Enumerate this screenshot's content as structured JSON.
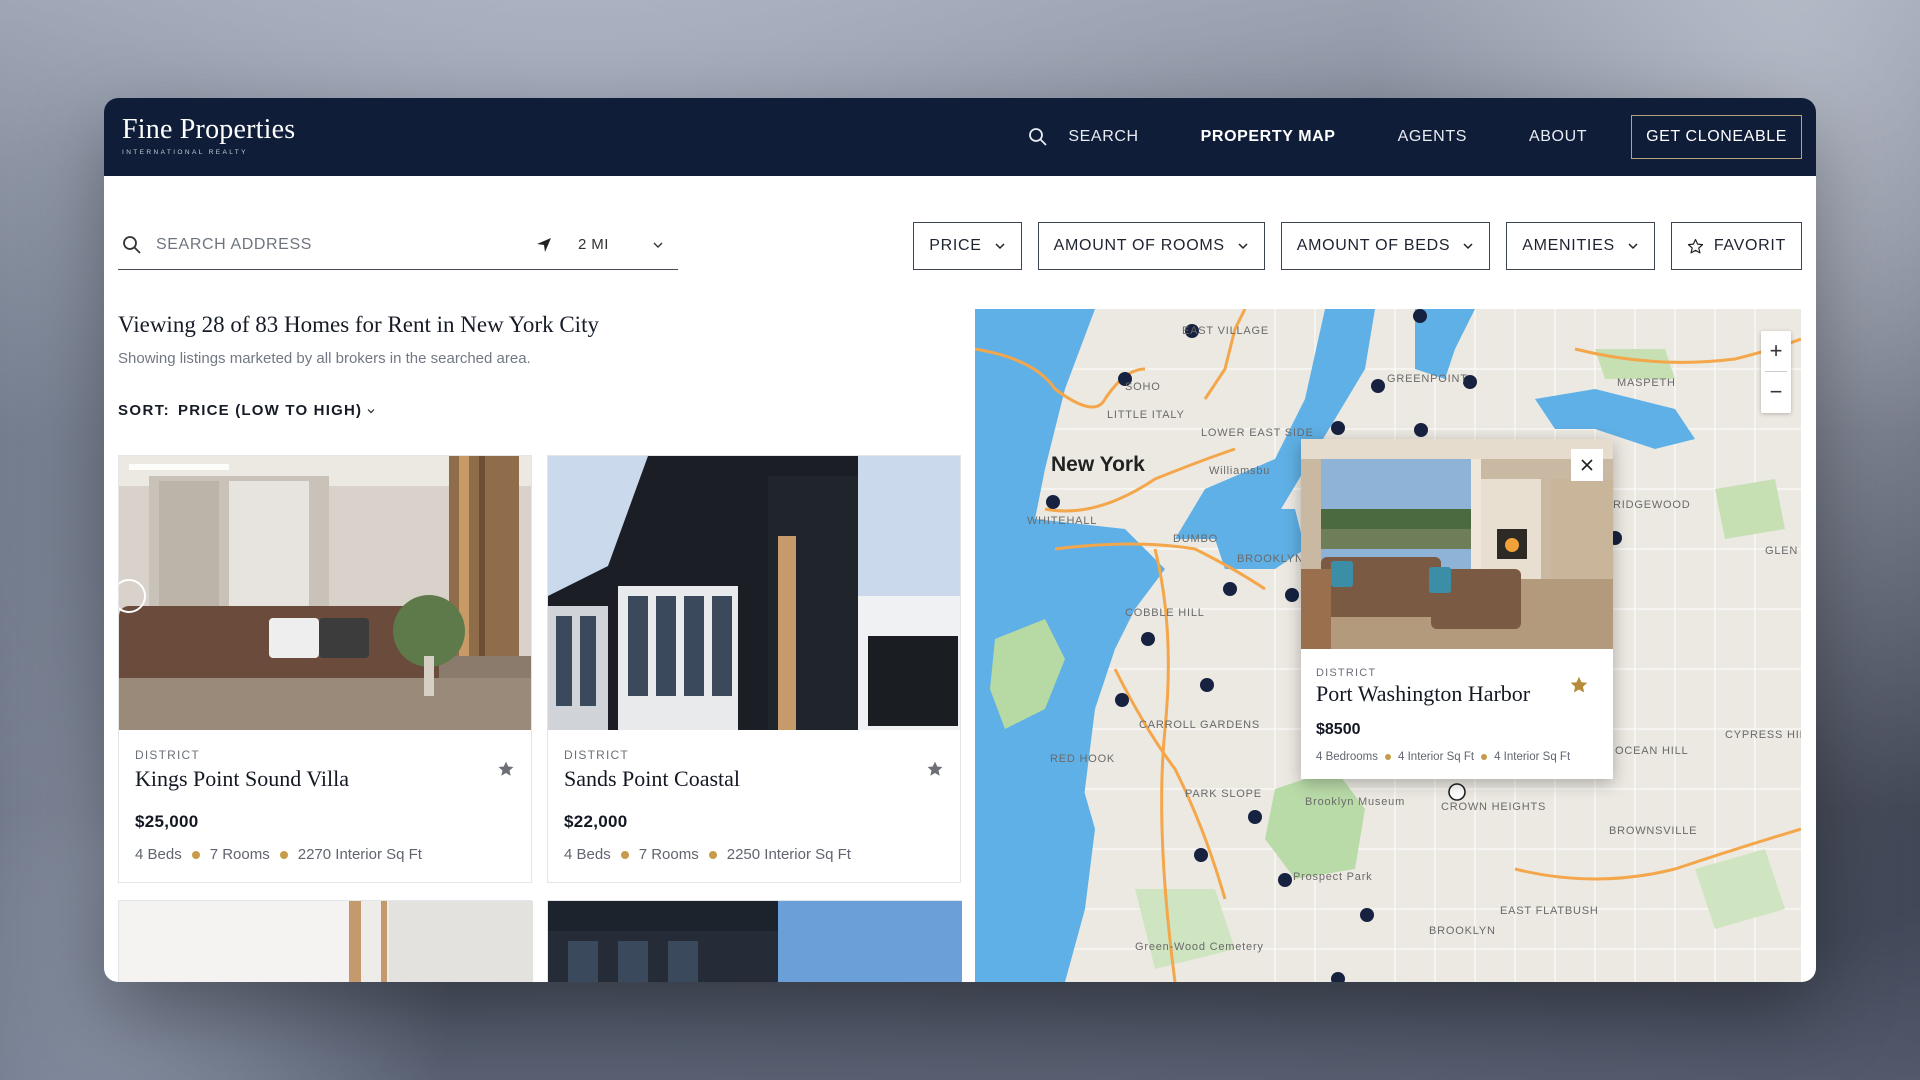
{
  "header": {
    "logo_name": "Fine Properties",
    "logo_sub": "INTERNATIONAL REALTY",
    "nav": {
      "search": "SEARCH",
      "property_map": "PROPERTY MAP",
      "agents": "AGENTS",
      "about": "ABOUT",
      "cta": "GET CLONEABLE"
    }
  },
  "search": {
    "placeholder": "SEARCH ADDRESS",
    "radius": "2 MI"
  },
  "filters": {
    "price": "PRICE",
    "rooms": "AMOUNT OF ROOMS",
    "beds": "AMOUNT OF BEDS",
    "amenities": "AMENITIES",
    "favorit": "FAVORIT"
  },
  "results": {
    "title": "Viewing 28 of 83 Homes for Rent in New York City",
    "subtitle": "Showing listings marketed by all brokers in the searched area.",
    "sort_label": "SORT:",
    "sort_value": "PRICE (LOW TO HIGH)"
  },
  "listings": [
    {
      "district": "DISTRICT",
      "name": "Kings Point Sound Villa",
      "price": "$25,000",
      "beds": "4 Beds",
      "rooms": "7 Rooms",
      "area": "2270 Interior Sq Ft"
    },
    {
      "district": "DISTRICT",
      "name": "Sands Point Coastal",
      "price": "$22,000",
      "beds": "4 Beds",
      "rooms": "7 Rooms",
      "area": "2250 Interior Sq Ft"
    }
  ],
  "map": {
    "city_label": "New York",
    "labels": {
      "east_village": "EAST VILLAGE",
      "soho": "SOHO",
      "little_italy": "LITTLE ITALY",
      "lower_east_side": "LOWER EAST SIDE",
      "whitehall": "WHITEHALL",
      "dumbo": "DUMBO",
      "brooklyn_navy_yard": "BROOKLYN NAVY YARD",
      "cobble_hill": "COBBLE HILL",
      "carroll_gardens": "CARROLL GARDENS",
      "red_hook": "RED HOOK",
      "park_slope": "PARK SLOPE",
      "brooklyn_museum": "Brooklyn Museum",
      "prospect_park": "Prospect Park",
      "green_wood": "Green-Wood Cemetery",
      "crown_heights": "CROWN HEIGHTS",
      "brownsville": "BROWNSVILLE",
      "flatbush": "EAST FLATBUSH",
      "brooklyn": "BROOKLYN",
      "greenpoint": "GREENPOINT",
      "maspeth": "MASPETH",
      "ridgewood": "RIDGEWOOD",
      "ocean_hill": "OCEAN HILL",
      "cypress_hills": "CYPRESS HILLS",
      "glen": "GLEN",
      "williamsburg": "Williamsbu"
    },
    "zoom_in": "+",
    "zoom_out": "−",
    "popup": {
      "district": "DISTRICT",
      "name": "Port Washington Harbor",
      "price": "$8500",
      "bedrooms": "4 Bedrooms",
      "area1": "4 Interior Sq Ft",
      "area2": "4 Interior Sq Ft"
    }
  },
  "colors": {
    "nav_bg": "#0f1d38",
    "accent_gold": "#c79a4c",
    "water": "#5aaee4",
    "park": "#b9dba8",
    "marker": "#16223f"
  }
}
